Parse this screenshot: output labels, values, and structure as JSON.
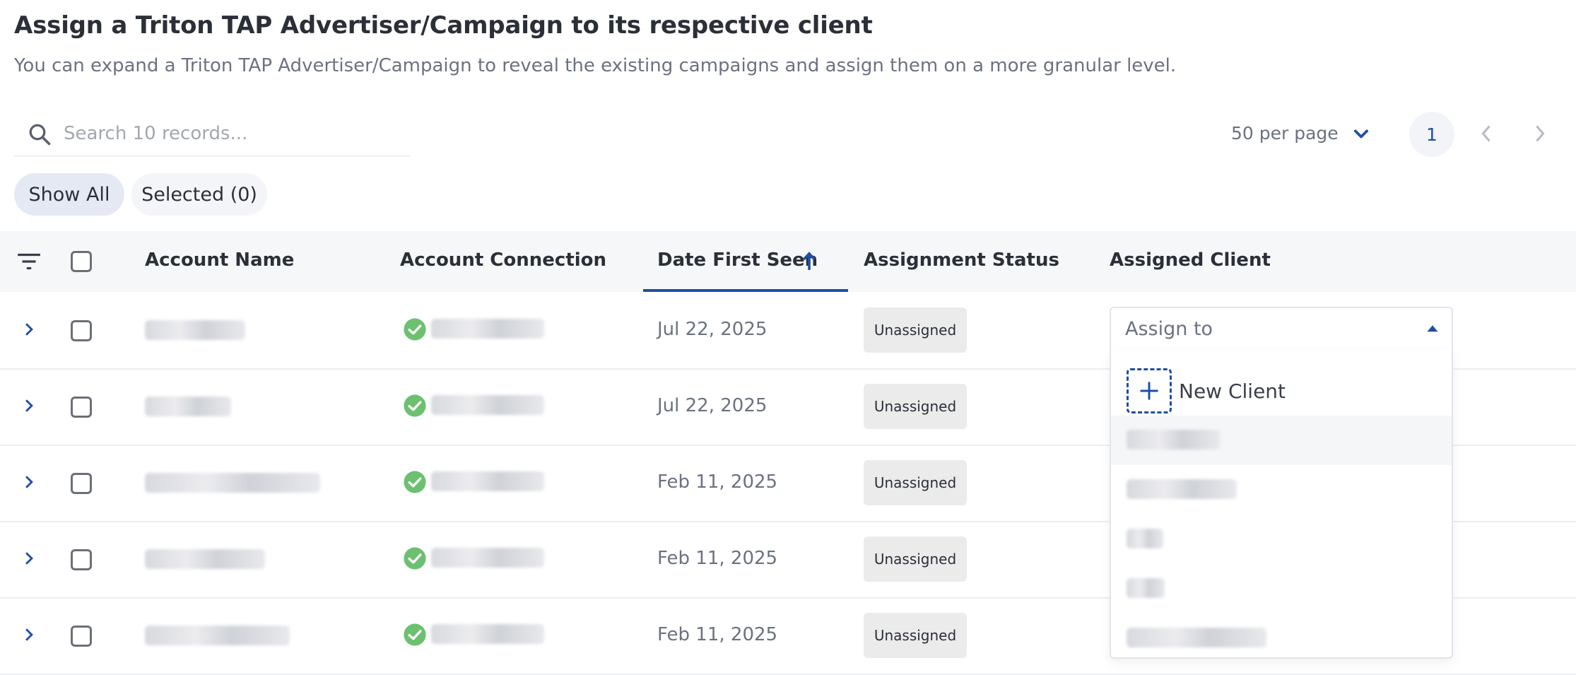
{
  "header": {
    "title": "Assign a Triton TAP Advertiser/Campaign to its respective client",
    "subtitle": "You can expand a Triton TAP Advertiser/Campaign to reveal the existing campaigns and assign them on a more granular level."
  },
  "search": {
    "placeholder": "Search 10 records..."
  },
  "pagination": {
    "per_page": "50 per page",
    "current_page": "1"
  },
  "filters": {
    "show_all": "Show All",
    "selected": "Selected (0)"
  },
  "table": {
    "columns": {
      "account_name": "Account Name",
      "account_connection": "Account Connection",
      "date_first_seen": "Date First Seen",
      "assignment_status": "Assignment Status",
      "assigned_client": "Assigned Client"
    },
    "rows": [
      {
        "date": "Jul 22, 2025",
        "status": "Unassigned"
      },
      {
        "date": "Jul 22, 2025",
        "status": "Unassigned"
      },
      {
        "date": "Feb 11, 2025",
        "status": "Unassigned"
      },
      {
        "date": "Feb 11, 2025",
        "status": "Unassigned"
      },
      {
        "date": "Feb 11, 2025",
        "status": "Unassigned"
      }
    ]
  },
  "dropdown": {
    "value": "Assign to",
    "new_client": "New Client"
  },
  "icons": {
    "search": "search-icon",
    "chevron_down": "chevron-down-icon",
    "prev": "chevron-left-icon",
    "next": "chevron-right-icon",
    "filter": "filter-icon",
    "sort_up": "arrow-up-icon",
    "expand": "chevron-right-icon",
    "connected": "check-circle-icon",
    "caret_up": "caret-up-icon",
    "plus": "plus-icon"
  },
  "colors": {
    "accent": "#1f4fa3",
    "success": "#6cc070",
    "badge_bg": "#ebebeb"
  }
}
